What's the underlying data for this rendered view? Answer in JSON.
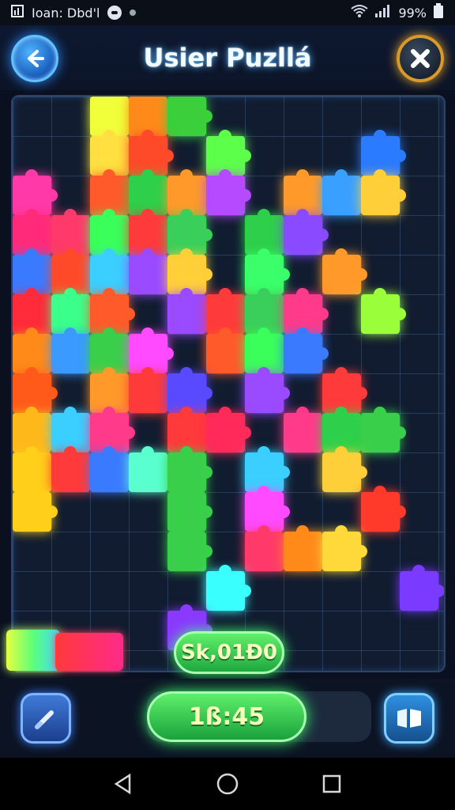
{
  "status_bar": {
    "carrier_text": "Ioan: Dbd'l",
    "battery": "99%"
  },
  "header": {
    "title": "Usier Puzllá"
  },
  "score": {
    "text": "Sk,01Ð0"
  },
  "timer": {
    "text": "1ß:45"
  },
  "icons": {
    "back": "arrow-left-icon",
    "close": "close-icon",
    "hint": "wand-icon",
    "pieces": "pieces-icon",
    "nav_back": "triangle-back-icon",
    "nav_home": "circle-home-icon",
    "nav_recent": "square-recent-icon"
  },
  "colors": {
    "accent_green": "#3cff6a",
    "accent_blue": "#2d8cff",
    "close_ring": "#d89a2a"
  }
}
